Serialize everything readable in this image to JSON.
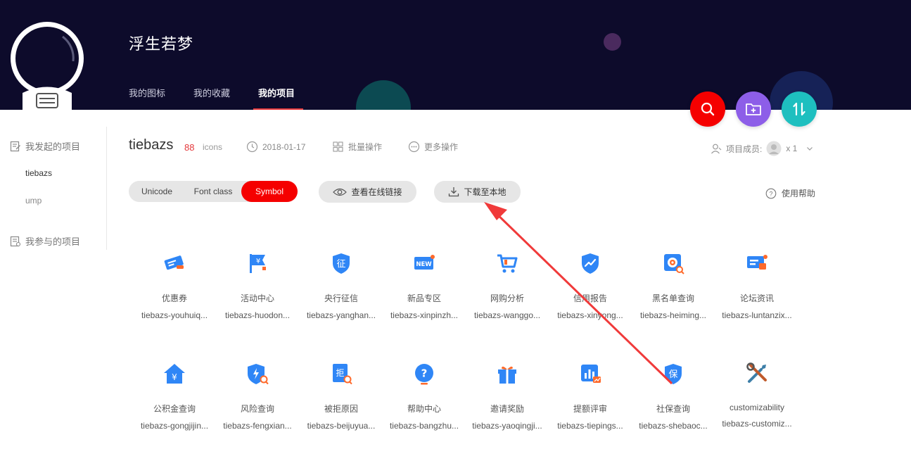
{
  "user": {
    "name": "浮生若梦"
  },
  "nav": {
    "tabs": [
      "我的图标",
      "我的收藏",
      "我的项目"
    ],
    "active": 2
  },
  "sidebar": {
    "started_title": "我发起的项目",
    "projects": [
      "tiebazs",
      "ump"
    ],
    "joined_title": "我参与的项目"
  },
  "project": {
    "name": "tiebazs",
    "count": "88",
    "count_unit": "icons",
    "date": "2018-01-17",
    "batch_label": "批量操作",
    "more_label": "更多操作",
    "members_label": "项目成员:",
    "members_count": "x 1"
  },
  "tabs": {
    "unicode": "Unicode",
    "font_class": "Font class",
    "symbol": "Symbol"
  },
  "buttons": {
    "view_link": "查看在线链接",
    "download": "下载至本地",
    "help": "使用帮助"
  },
  "colors": {
    "accent": "#f50000",
    "icon_blue": "#2f86f6",
    "header_bg": "#0d0b2b"
  },
  "icons": [
    {
      "name": "优惠券",
      "code": "tiebazs-youhuiq...",
      "icon": "coupon-icon"
    },
    {
      "name": "活动中心",
      "code": "tiebazs-huodon...",
      "icon": "flag-yen-icon"
    },
    {
      "name": "央行征信",
      "code": "tiebazs-yanghan...",
      "icon": "shield-credit-icon"
    },
    {
      "name": "新品专区",
      "code": "tiebazs-xinpinzh...",
      "icon": "new-badge-icon"
    },
    {
      "name": "网购分析",
      "code": "tiebazs-wanggo...",
      "icon": "cart-icon"
    },
    {
      "name": "信用报告",
      "code": "tiebazs-xinyong...",
      "icon": "shield-trend-icon"
    },
    {
      "name": "黑名单查询",
      "code": "tiebazs-heiming...",
      "icon": "blacklist-search-icon"
    },
    {
      "name": "论坛资讯",
      "code": "tiebazs-luntanzix...",
      "icon": "forum-icon"
    },
    {
      "name": "公积金查询",
      "code": "tiebazs-gongjijin...",
      "icon": "house-yen-icon"
    },
    {
      "name": "风险查询",
      "code": "tiebazs-fengxian...",
      "icon": "risk-search-icon"
    },
    {
      "name": "被拒原因",
      "code": "tiebazs-beijuyua...",
      "icon": "reject-search-icon"
    },
    {
      "name": "帮助中心",
      "code": "tiebazs-bangzhu...",
      "icon": "question-icon"
    },
    {
      "name": "邀请奖励",
      "code": "tiebazs-yaoqingji...",
      "icon": "gift-icon"
    },
    {
      "name": "提额评审",
      "code": "tiebazs-tiepings...",
      "icon": "chart-review-icon"
    },
    {
      "name": "社保查询",
      "code": "tiebazs-shebaoc...",
      "icon": "shield-bao-icon"
    },
    {
      "name": "customizability",
      "code": "tiebazs-customiz...",
      "icon": "tools-icon"
    }
  ]
}
